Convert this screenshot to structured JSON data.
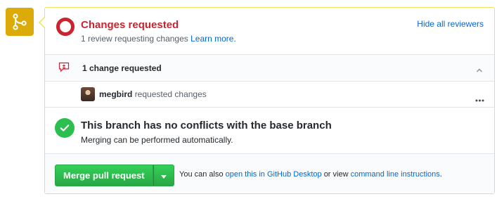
{
  "status": {
    "title": "Changes requested",
    "subtitle": "1 review requesting changes",
    "learn_more": "Learn more.",
    "hide_reviewers": "Hide all reviewers"
  },
  "changes": {
    "label": "1 change requested"
  },
  "reviewer": {
    "name": "megbird",
    "action": "requested changes"
  },
  "branch": {
    "title": "This branch has no conflicts with the base branch",
    "subtitle": "Merging can be performed automatically."
  },
  "merge": {
    "button_label": "Merge pull request",
    "note_prefix": "You can also",
    "desktop_link": "open this in GitHub Desktop",
    "note_middle": "or view",
    "cli_link": "command line instructions",
    "note_suffix": "."
  },
  "colors": {
    "badge": "#dbab09",
    "changes_requested": "#cb2431",
    "success": "#2cbe4e",
    "link": "#0366d6",
    "card_border": "#f1e05a"
  },
  "icons": {
    "badge": "git-merge-icon",
    "status": "changes-requested-ring-icon",
    "changes": "file-diff-icon",
    "collapse": "chevron-up-icon",
    "more": "kebab-horizontal-icon",
    "check": "check-icon",
    "dropdown": "triangle-down-icon"
  }
}
